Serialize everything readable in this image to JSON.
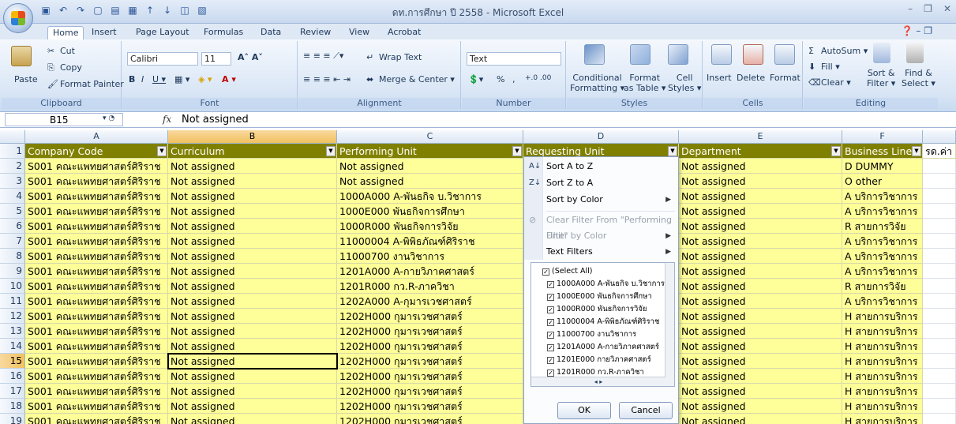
{
  "window": {
    "title": "ดท.การศึกษา ปี 2558 - Microsoft Excel"
  },
  "tabs": [
    "Home",
    "Insert",
    "Page Layout",
    "Formulas",
    "Data",
    "Review",
    "View",
    "Acrobat"
  ],
  "ribbon": {
    "clipboard": {
      "label": "Clipboard",
      "paste": "Paste",
      "cut": "Cut",
      "copy": "Copy",
      "format_painter": "Format Painter"
    },
    "font": {
      "label": "Font",
      "name": "Calibri",
      "size": "11"
    },
    "alignment": {
      "label": "Alignment",
      "wrap": "Wrap Text",
      "merge": "Merge & Center"
    },
    "number": {
      "label": "Number",
      "format": "Text",
      "percent": "%",
      "comma": ","
    },
    "styles": {
      "label": "Styles",
      "conditional": "Conditional",
      "conditional2": "Formatting",
      "format_table": "Format",
      "format_table2": "as Table",
      "cell_styles": "Cell",
      "cell_styles2": "Styles"
    },
    "cells": {
      "label": "Cells",
      "insert": "Insert",
      "delete": "Delete",
      "format": "Format"
    },
    "editing": {
      "label": "Editing",
      "autosum": "AutoSum",
      "fill": "Fill",
      "clear": "Clear",
      "sort": "Sort &",
      "sort2": "Filter",
      "find": "Find &",
      "find2": "Select"
    }
  },
  "formula_bar": {
    "name_box": "B15",
    "fx": "fx",
    "value": "Not assigned"
  },
  "columns": [
    "A",
    "B",
    "C",
    "D",
    "E",
    "F"
  ],
  "headers": [
    "Company Code",
    "Curriculum",
    "Performing Unit",
    "Requesting Unit",
    "Department",
    "Business Line",
    "รด.ค่า"
  ],
  "rows": [
    {
      "n": "1"
    },
    {
      "n": "2",
      "a": "S001 คณะแพทยศาสตร์ศิริราช",
      "b": "Not assigned",
      "c": "Not assigned",
      "e": "Not assigned",
      "f": "D DUMMY"
    },
    {
      "n": "3",
      "a": "S001 คณะแพทยศาสตร์ศิริราช",
      "b": "Not assigned",
      "c": "Not assigned",
      "e": "Not assigned",
      "f": "O other"
    },
    {
      "n": "4",
      "a": "S001 คณะแพทยศาสตร์ศิริราช",
      "b": "Not assigned",
      "c": "1000A000 A-พันธกิจ  บ.วิชาการ",
      "e": "Not assigned",
      "f": "A บริการวิชาการ"
    },
    {
      "n": "5",
      "a": "S001 คณะแพทยศาสตร์ศิริราช",
      "b": "Not assigned",
      "c": "1000E000 พันธกิจการศึกษา",
      "e": "Not assigned",
      "f": "A บริการวิชาการ"
    },
    {
      "n": "6",
      "a": "S001 คณะแพทยศาสตร์ศิริราช",
      "b": "Not assigned",
      "c": "1000R000 พันธกิจการวิจัย",
      "e": "Not assigned",
      "f": "R สายการวิจัย"
    },
    {
      "n": "7",
      "a": "S001 คณะแพทยศาสตร์ศิริราช",
      "b": "Not assigned",
      "c": "11000004 A-พิพิธภัณฑ์ศิริราช",
      "e": "Not assigned",
      "f": "A บริการวิชาการ"
    },
    {
      "n": "8",
      "a": "S001 คณะแพทยศาสตร์ศิริราช",
      "b": "Not assigned",
      "c": "11000700 งานวิชาการ",
      "e": "Not assigned",
      "f": "A บริการวิชาการ"
    },
    {
      "n": "9",
      "a": "S001 คณะแพทยศาสตร์ศิริราช",
      "b": "Not assigned",
      "c": "1201A000 A-กายวิภาคศาสตร์",
      "e": "Not assigned",
      "f": "A บริการวิชาการ"
    },
    {
      "n": "10",
      "a": "S001 คณะแพทยศาสตร์ศิริราช",
      "b": "Not assigned",
      "c": "1201R000 กว.R-ภาควิชา",
      "e": "Not assigned",
      "f": "R สายการวิจัย"
    },
    {
      "n": "11",
      "a": "S001 คณะแพทยศาสตร์ศิริราช",
      "b": "Not assigned",
      "c": "1202A000 A-กุมารเวชศาสตร์",
      "e": "Not assigned",
      "f": "A บริการวิชาการ"
    },
    {
      "n": "12",
      "a": "S001 คณะแพทยศาสตร์ศิริราช",
      "b": "Not assigned",
      "c": "1202H000 กุมารเวชศาสตร์",
      "e": "Not assigned",
      "f": "H สายการบริการ"
    },
    {
      "n": "13",
      "a": "S001 คณะแพทยศาสตร์ศิริราช",
      "b": "Not assigned",
      "c": "1202H000 กุมารเวชศาสตร์",
      "e": "Not assigned",
      "f": "H สายการบริการ"
    },
    {
      "n": "14",
      "a": "S001 คณะแพทยศาสตร์ศิริราช",
      "b": "Not assigned",
      "c": "1202H000 กุมารเวชศาสตร์",
      "e": "Not assigned",
      "f": "H สายการบริการ"
    },
    {
      "n": "15",
      "a": "S001 คณะแพทยศาสตร์ศิริราช",
      "b": "Not assigned",
      "c": "1202H000 กุมารเวชศาสตร์",
      "e": "Not assigned",
      "f": "H สายการบริการ"
    },
    {
      "n": "16",
      "a": "S001 คณะแพทยศาสตร์ศิริราช",
      "b": "Not assigned",
      "c": "1202H000 กุมารเวชศาสตร์",
      "e": "Not assigned",
      "f": "H สายการบริการ"
    },
    {
      "n": "17",
      "a": "S001 คณะแพทยศาสตร์ศิริราช",
      "b": "Not assigned",
      "c": "1202H000 กุมารเวชศาสตร์",
      "e": "Not assigned",
      "f": "H สายการบริการ"
    },
    {
      "n": "18",
      "a": "S001 คณะแพทยศาสตร์ศิริราช",
      "b": "Not assigned",
      "c": "1202H000 กุมารเวชศาสตร์",
      "e": "Not assigned",
      "f": "H สายการบริการ"
    },
    {
      "n": "19",
      "a": "S001 คณะแพทยศาสตร์ศิริราช",
      "b": "Not assigned",
      "c": "1202H000 กุมารเวชศาสตร์",
      "e": "Not assigned",
      "f": "H สายการบริการ"
    }
  ],
  "filter_menu": {
    "sort_az": "Sort A to Z",
    "sort_za": "Sort Z to A",
    "sort_color": "Sort by Color",
    "clear_filter": "Clear Filter From \"Performing Unit\"",
    "filter_color": "Filter by Color",
    "text_filters": "Text Filters",
    "list": [
      "(Select All)",
      "1000A000 A-พันธกิจ บ.วิชาการ",
      "1000E000 พันธกิจการศึกษา",
      "1000R000 พันธกิจการวิจัย",
      "11000004 A-พิพิธภัณฑ์ศิริราช",
      "11000700 งานวิชาการ",
      "1201A000 A-กายวิภาคศาสตร์",
      "1201E000 กายวิภาคศาสตร์",
      "1201R000 กว.R-ภาควิชา"
    ],
    "ok": "OK",
    "cancel": "Cancel"
  },
  "colors": {
    "header_bg": "#808000",
    "cell_bg": "#ffff99",
    "selected_col": "#f1c15f"
  }
}
